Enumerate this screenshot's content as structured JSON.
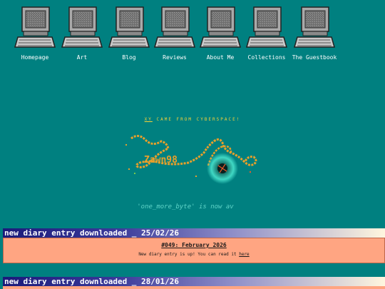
{
  "nav": {
    "items": [
      {
        "label": "Homepage"
      },
      {
        "label": "Art"
      },
      {
        "label": "Blog"
      },
      {
        "label": "Reviews"
      },
      {
        "label": "About Me"
      },
      {
        "label": "Collections"
      },
      {
        "label": "The Guestbook"
      }
    ]
  },
  "banner": {
    "tagline_prefix": "XY",
    "tagline_rest": " CAME FROM CYBERSPACE!",
    "logo_text": "Zawn98",
    "marquee": "on 'one_more_byte' is now av"
  },
  "diary": {
    "entries": [
      {
        "header": "new diary entry downloaded _ 25/02/26",
        "title": "#049: February 2026",
        "text": "New diary entry is up! You can read it ",
        "link": "here"
      },
      {
        "header": "new diary entry downloaded _ 28/01/26"
      }
    ]
  },
  "colors": {
    "background": "#008080",
    "entry_body": "#ffa582",
    "tagline": "#f2d23a"
  }
}
